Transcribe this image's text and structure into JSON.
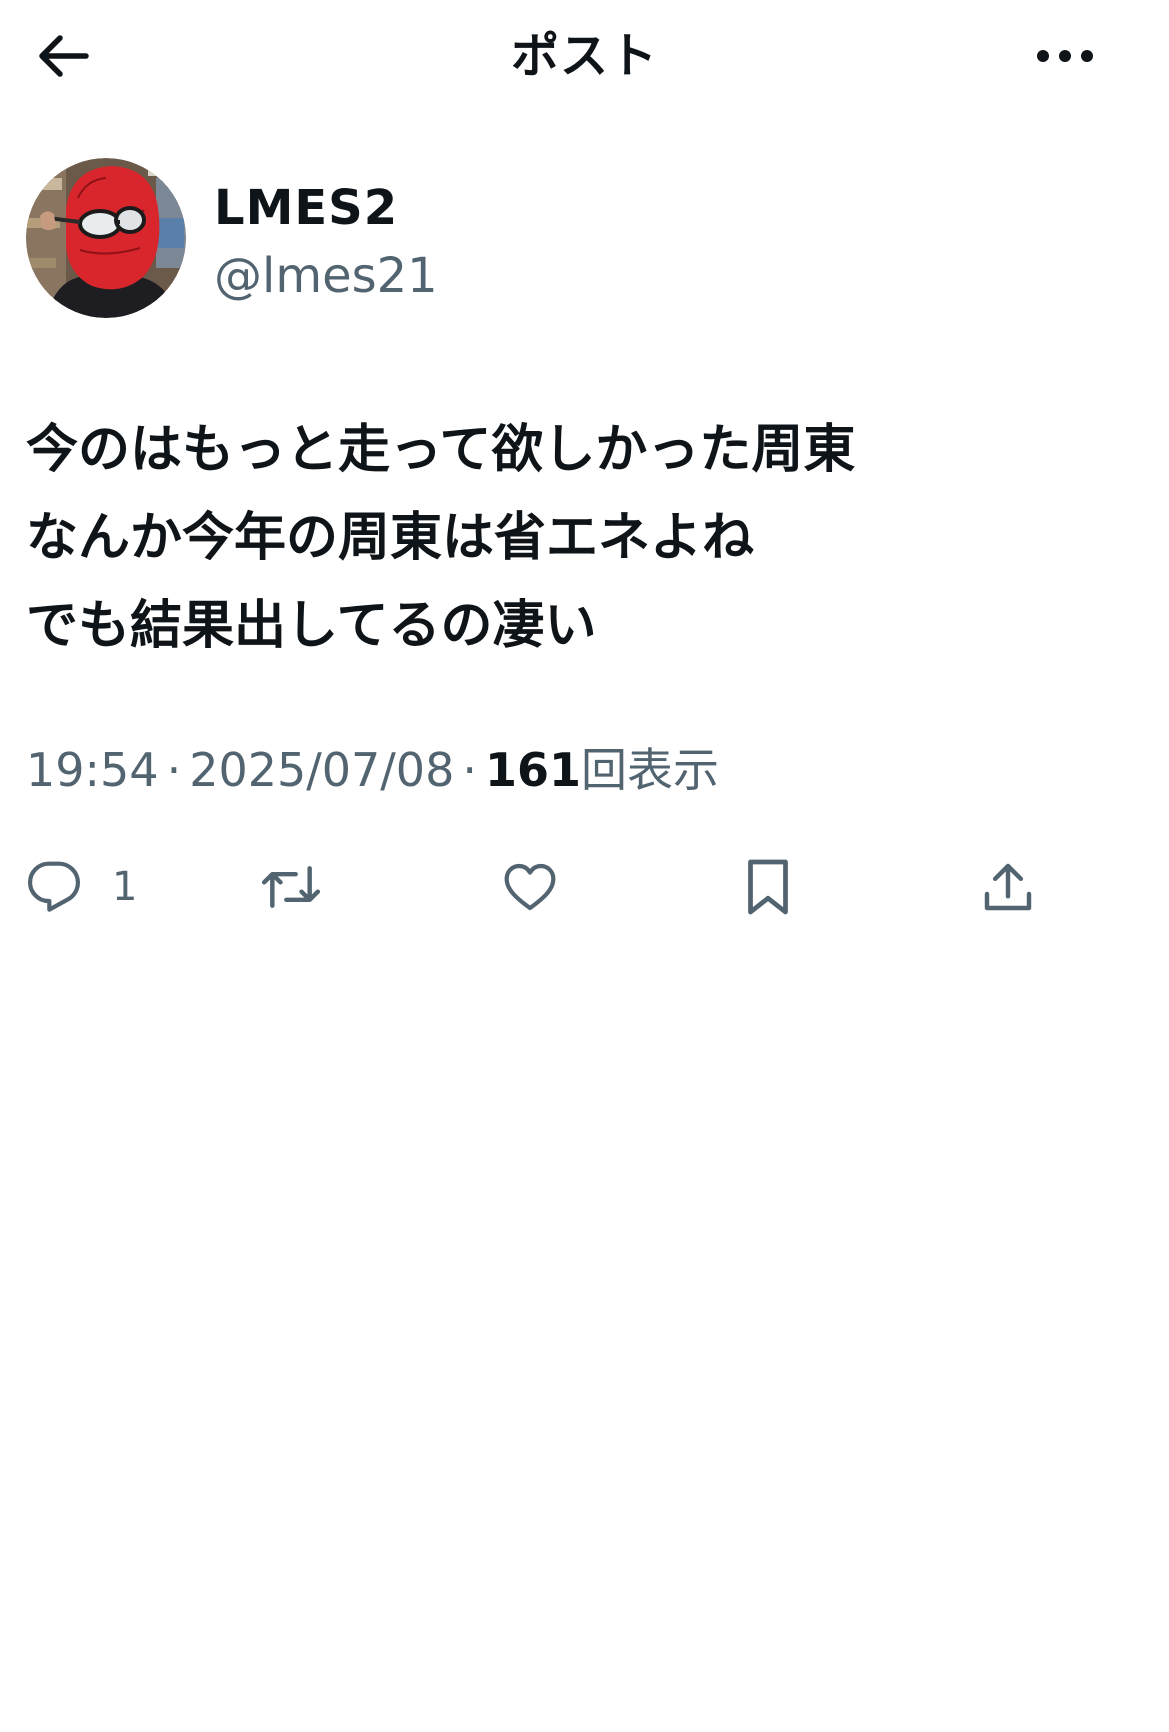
{
  "header": {
    "title": "ポスト",
    "back_icon": "arrow-left-icon",
    "more_icon": "more-horizontal-icon"
  },
  "author": {
    "display_name": "LMES2",
    "handle": "@lmes21",
    "avatar_icon": "avatar-red-mask"
  },
  "tweet": {
    "lines": [
      "今のはもっと走って欲しかった周東",
      "なんか今年の周東は省エネよね",
      "でも結果出してるの凄い"
    ]
  },
  "meta": {
    "time": "19:54",
    "separator": "·",
    "date": "2025/07/08",
    "views_count": "161",
    "views_label": "回表示"
  },
  "actions": {
    "reply_count": "1",
    "reply_icon": "reply-icon",
    "retweet_icon": "retweet-icon",
    "like_icon": "heart-icon",
    "bookmark_icon": "bookmark-icon",
    "share_icon": "share-icon"
  },
  "colors": {
    "text": "#0f1419",
    "secondary": "#536471",
    "background": "#ffffff"
  }
}
